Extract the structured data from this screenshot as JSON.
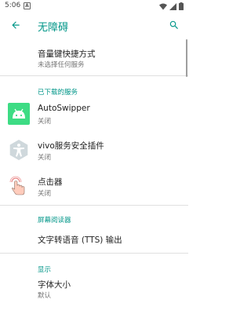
{
  "status_bar": {
    "time": "5:06",
    "notification_letter": "A"
  },
  "app_bar": {
    "title": "无障碍"
  },
  "items": {
    "volume_shortcut": {
      "title": "音量键快捷方式",
      "subtitle": "未选择任何服务"
    },
    "autoswipper": {
      "title": "AutoSwipper",
      "subtitle": "关闭"
    },
    "vivo_plugin": {
      "title": "vivo服务安全插件",
      "subtitle": "关闭"
    },
    "clicker": {
      "title": "点击器",
      "subtitle": "关闭"
    },
    "tts": {
      "title": "文字转语音 (TTS) 输出"
    },
    "font_size": {
      "title": "字体大小",
      "subtitle": "默认"
    }
  },
  "sections": {
    "downloaded": "已下载的服务",
    "screen_reader": "屏幕阅读器",
    "display": "显示"
  },
  "colors": {
    "accent": "#009688",
    "android_green": "#3ddc84"
  }
}
